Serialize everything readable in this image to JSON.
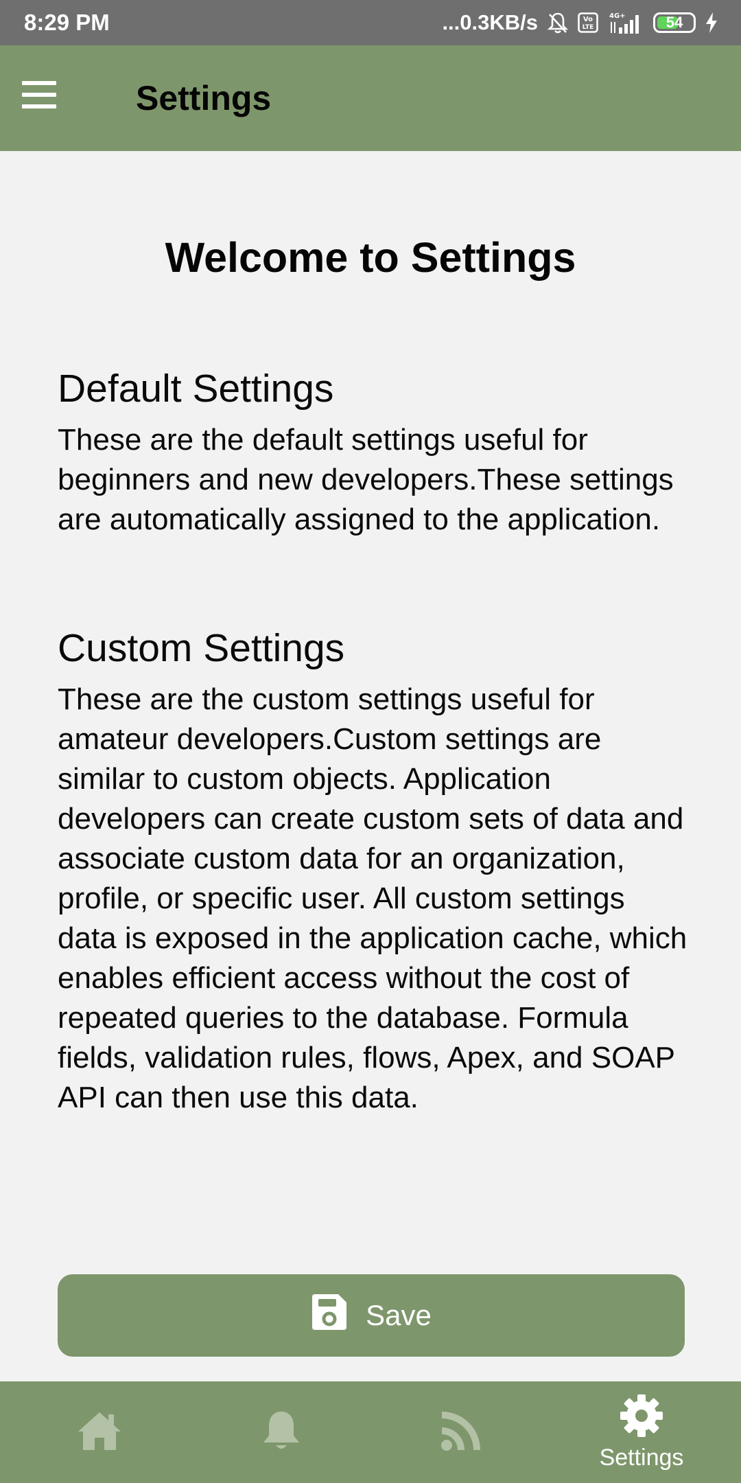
{
  "status_bar": {
    "time": "8:29 PM",
    "network_speed": "...0.3KB/s",
    "battery_level": "54",
    "icons": [
      "mute-bell-icon",
      "volte-icon",
      "signal-4g-icon",
      "battery-icon",
      "charging-bolt-icon"
    ]
  },
  "app_bar": {
    "title": "Settings",
    "menu_icon": "hamburger-menu-icon",
    "color": "#7e966b"
  },
  "main": {
    "welcome_title": "Welcome to Settings",
    "sections": [
      {
        "heading": "Default Settings",
        "body": "These are the default settings useful for beginners and new developers.These settings are automatically assigned to the application."
      },
      {
        "heading": "Custom Settings",
        "body": "These are the custom settings useful for amateur developers.Custom settings are similar to custom objects. Application developers can create custom sets of data and associate custom data for an organization, profile, or specific user. All custom settings data is exposed in the application cache, which enables efficient access without the cost of repeated queries to the database. Formula fields, validation rules, flows, Apex, and SOAP API can then use this data."
      }
    ],
    "save_button": {
      "label": "Save",
      "icon": "floppy-disk-icon"
    }
  },
  "bottom_nav": {
    "items": [
      {
        "icon": "home-icon",
        "label": "",
        "active": false
      },
      {
        "icon": "bell-icon",
        "label": "",
        "active": false
      },
      {
        "icon": "rss-feed-icon",
        "label": "",
        "active": false
      },
      {
        "icon": "gear-icon",
        "label": "Settings",
        "active": true
      }
    ],
    "colors": {
      "active": "#ffffff",
      "inactive": "#b3c2a6",
      "background": "#7e966b"
    }
  }
}
